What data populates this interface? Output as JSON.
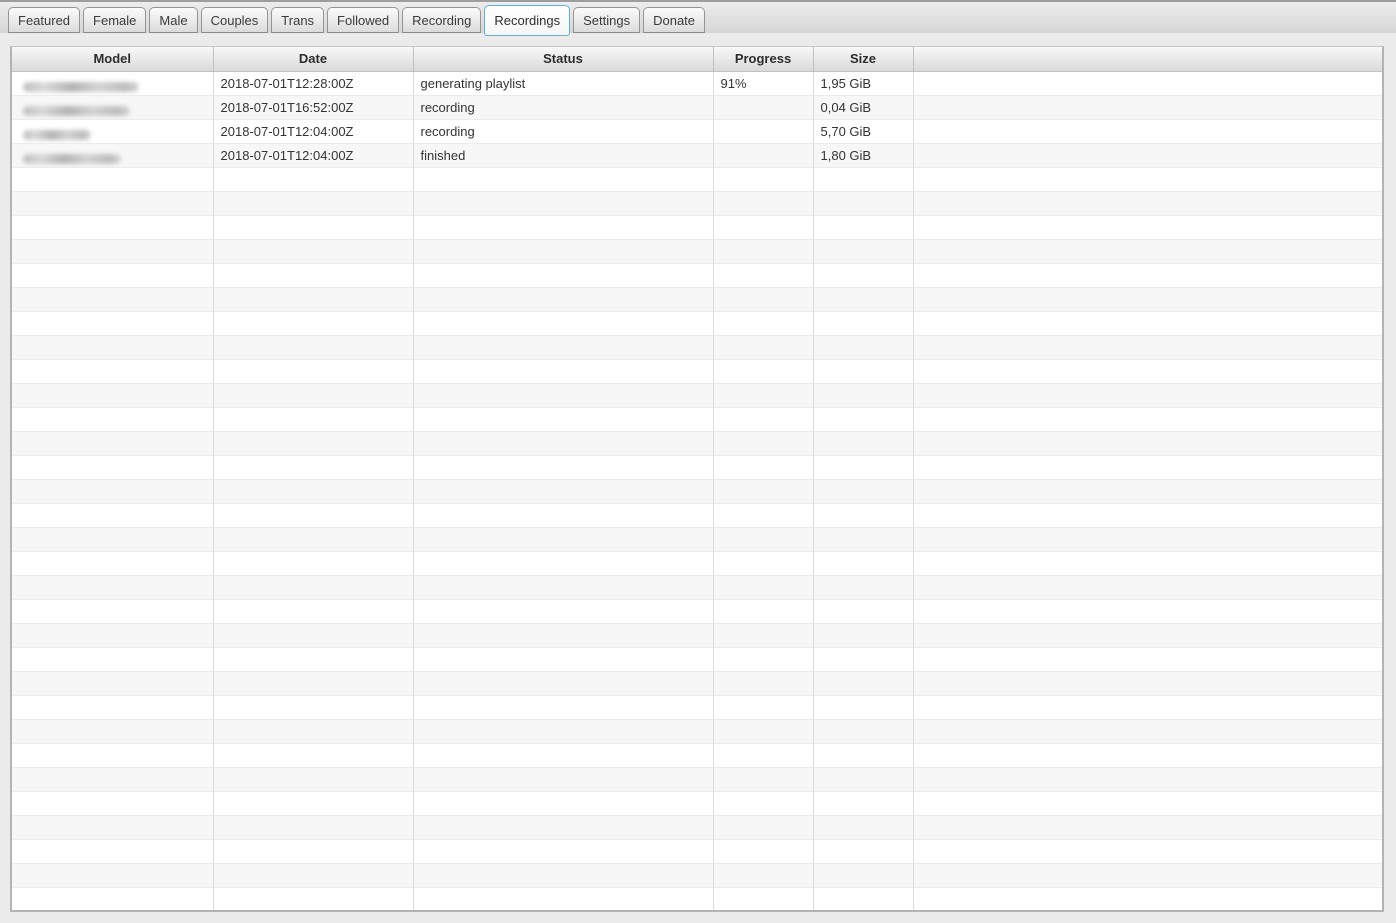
{
  "tabs": [
    {
      "label": "Featured",
      "active": false
    },
    {
      "label": "Female",
      "active": false
    },
    {
      "label": "Male",
      "active": false
    },
    {
      "label": "Couples",
      "active": false
    },
    {
      "label": "Trans",
      "active": false
    },
    {
      "label": "Followed",
      "active": false
    },
    {
      "label": "Recording",
      "active": false
    },
    {
      "label": "Recordings",
      "active": true
    },
    {
      "label": "Settings",
      "active": false
    },
    {
      "label": "Donate",
      "active": false
    }
  ],
  "table": {
    "columns": [
      "Model",
      "Date",
      "Status",
      "Progress",
      "Size",
      ""
    ],
    "rows": [
      {
        "model_redacted": true,
        "model_blur_width": 116,
        "date": "2018-07-01T12:28:00Z",
        "status": "generating playlist",
        "progress": "91%",
        "size": "1,95 GiB"
      },
      {
        "model_redacted": true,
        "model_blur_width": 107,
        "date": "2018-07-01T16:52:00Z",
        "status": "recording",
        "progress": "",
        "size": "0,04 GiB"
      },
      {
        "model_redacted": true,
        "model_blur_width": 68,
        "date": "2018-07-01T12:04:00Z",
        "status": "recording",
        "progress": "",
        "size": "5,70 GiB"
      },
      {
        "model_redacted": true,
        "model_blur_width": 98,
        "date": "2018-07-01T12:04:00Z",
        "status": "finished",
        "progress": "",
        "size": "1,80 GiB"
      }
    ],
    "empty_row_count": 31
  },
  "colors": {
    "active_tab_border": "#63b0de",
    "row_alt": "#f7f7f7",
    "header_text": "#2d2d2d",
    "cell_text": "#333333",
    "page_background": "#ebebeb"
  }
}
